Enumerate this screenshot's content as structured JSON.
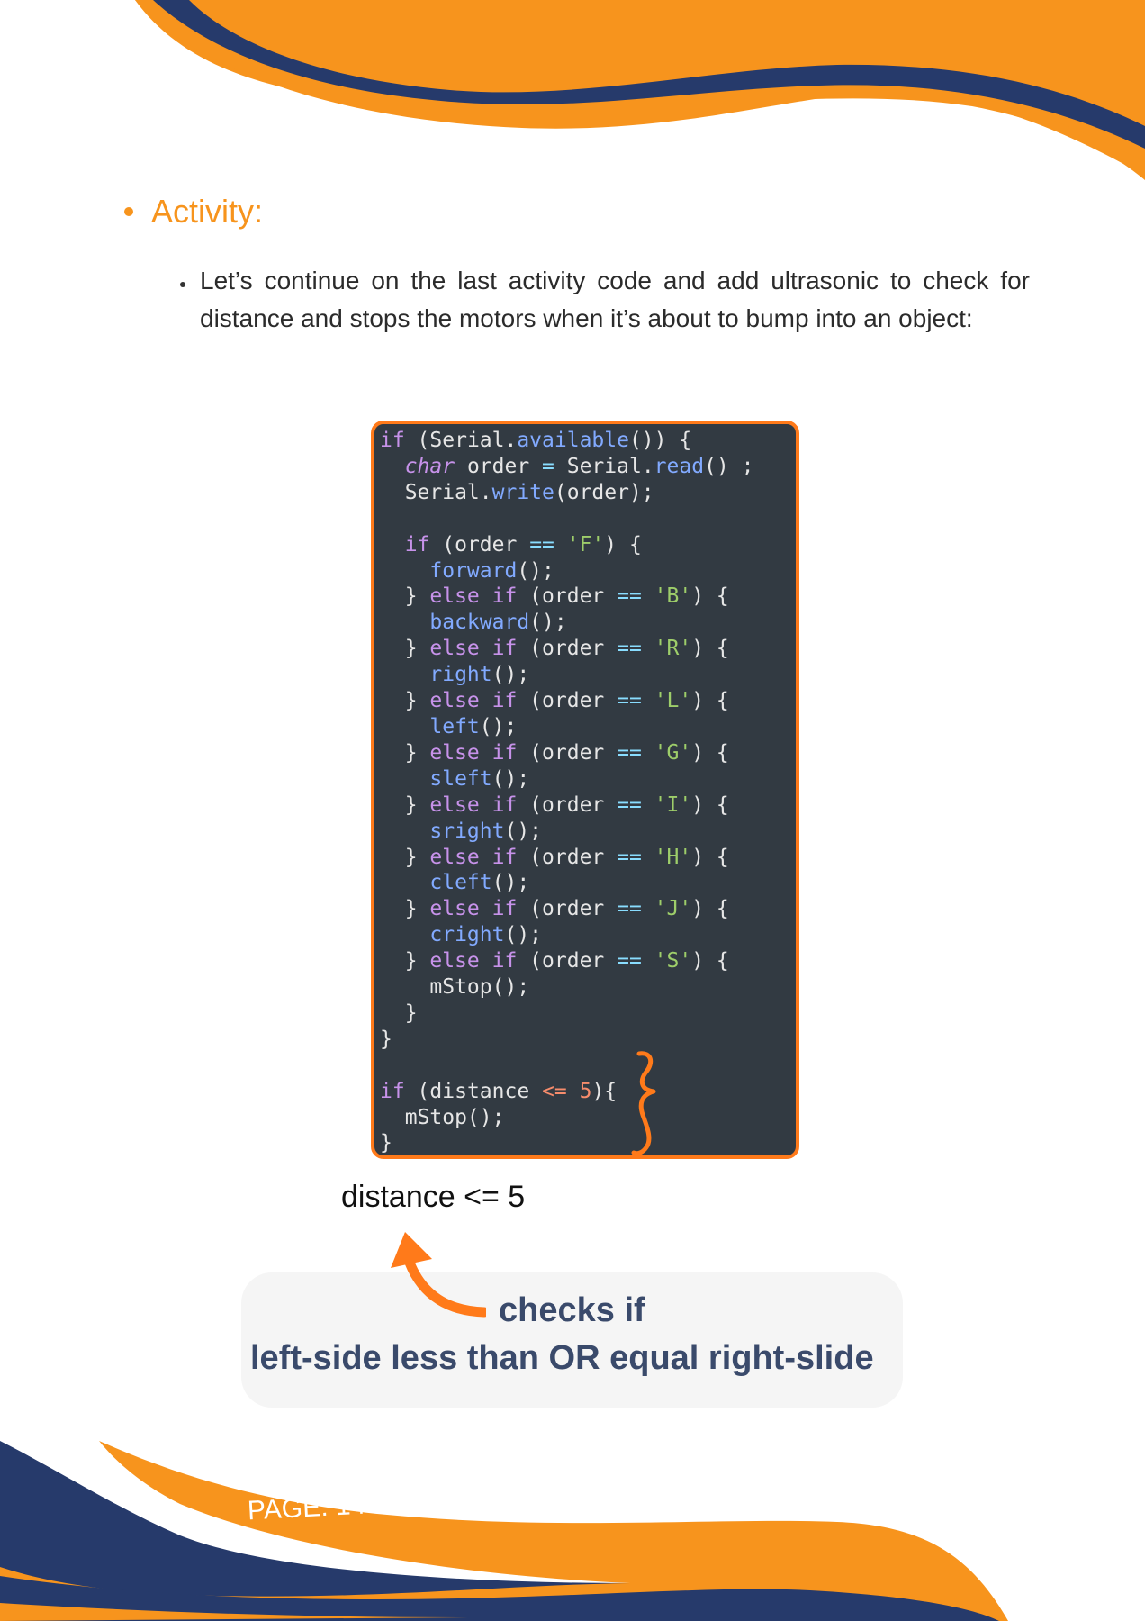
{
  "heading": "Activity:",
  "intro": "Let’s continue on the last activity code and add ultrasonic to check for distance and stops the motors when it’s about to bump into an object:",
  "code": {
    "l1": {
      "a": "if",
      "b": " (Serial.",
      "c": "available",
      "d": "()) {"
    },
    "l2": {
      "a": "  ",
      "b": "char",
      "c": " order ",
      "d": "=",
      "e": " Serial.",
      "f": "read",
      "g": "() ;"
    },
    "l3": {
      "a": "  Serial.",
      "b": "write",
      "c": "(order);"
    },
    "l5": {
      "a": "  ",
      "b": "if",
      "c": " (order ",
      "d": "==",
      "e": " 'F'",
      "f": ") {"
    },
    "l6": {
      "a": "    ",
      "b": "forward",
      "c": "();"
    },
    "l7": {
      "a": "  } ",
      "b": "else if",
      "c": " (order ",
      "d": "==",
      "e": " 'B'",
      "f": ") {"
    },
    "l8": {
      "a": "    ",
      "b": "backward",
      "c": "();"
    },
    "l9": {
      "a": "  } ",
      "b": "else if",
      "c": " (order ",
      "d": "==",
      "e": " 'R'",
      "f": ") {"
    },
    "l10": {
      "a": "    ",
      "b": "right",
      "c": "();"
    },
    "l11": {
      "a": "  } ",
      "b": "else if",
      "c": " (order ",
      "d": "==",
      "e": " 'L'",
      "f": ") {"
    },
    "l12": {
      "a": "    ",
      "b": "left",
      "c": "();"
    },
    "l13": {
      "a": "  } ",
      "b": "else if",
      "c": " (order ",
      "d": "==",
      "e": " 'G'",
      "f": ") {"
    },
    "l14": {
      "a": "    ",
      "b": "sleft",
      "c": "();"
    },
    "l15": {
      "a": "  } ",
      "b": "else if",
      "c": " (order ",
      "d": "==",
      "e": " 'I'",
      "f": ") {"
    },
    "l16": {
      "a": "    ",
      "b": "sright",
      "c": "();"
    },
    "l17": {
      "a": "  } ",
      "b": "else if",
      "c": " (order ",
      "d": "==",
      "e": " 'H'",
      "f": ") {"
    },
    "l18": {
      "a": "    ",
      "b": "cleft",
      "c": "();"
    },
    "l19": {
      "a": "  } ",
      "b": "else if",
      "c": " (order ",
      "d": "==",
      "e": " 'J'",
      "f": ") {"
    },
    "l20": {
      "a": "    ",
      "b": "cright",
      "c": "();"
    },
    "l21": {
      "a": "  } ",
      "b": "else if",
      "c": " (order ",
      "d": "==",
      "e": " 'S'",
      "f": ") {"
    },
    "l22": "    mStop();",
    "l23": "  }",
    "l24": "}",
    "l26": {
      "a": "if",
      "b": " (distance ",
      "c": "<=",
      "d": " 5",
      "e": "){"
    },
    "l27": "  mStop();",
    "l28": "}"
  },
  "expression": "distance <= 5",
  "note": {
    "line1": "checks if",
    "line2": "left-side less than OR equal right-slide"
  },
  "page_label": "PAGE: 14",
  "colors": {
    "orange": "#f7941d",
    "navy": "#263a6b",
    "code_bg": "#323a42",
    "code_border": "#ff7a1a",
    "note_text": "#3a4a6b"
  }
}
